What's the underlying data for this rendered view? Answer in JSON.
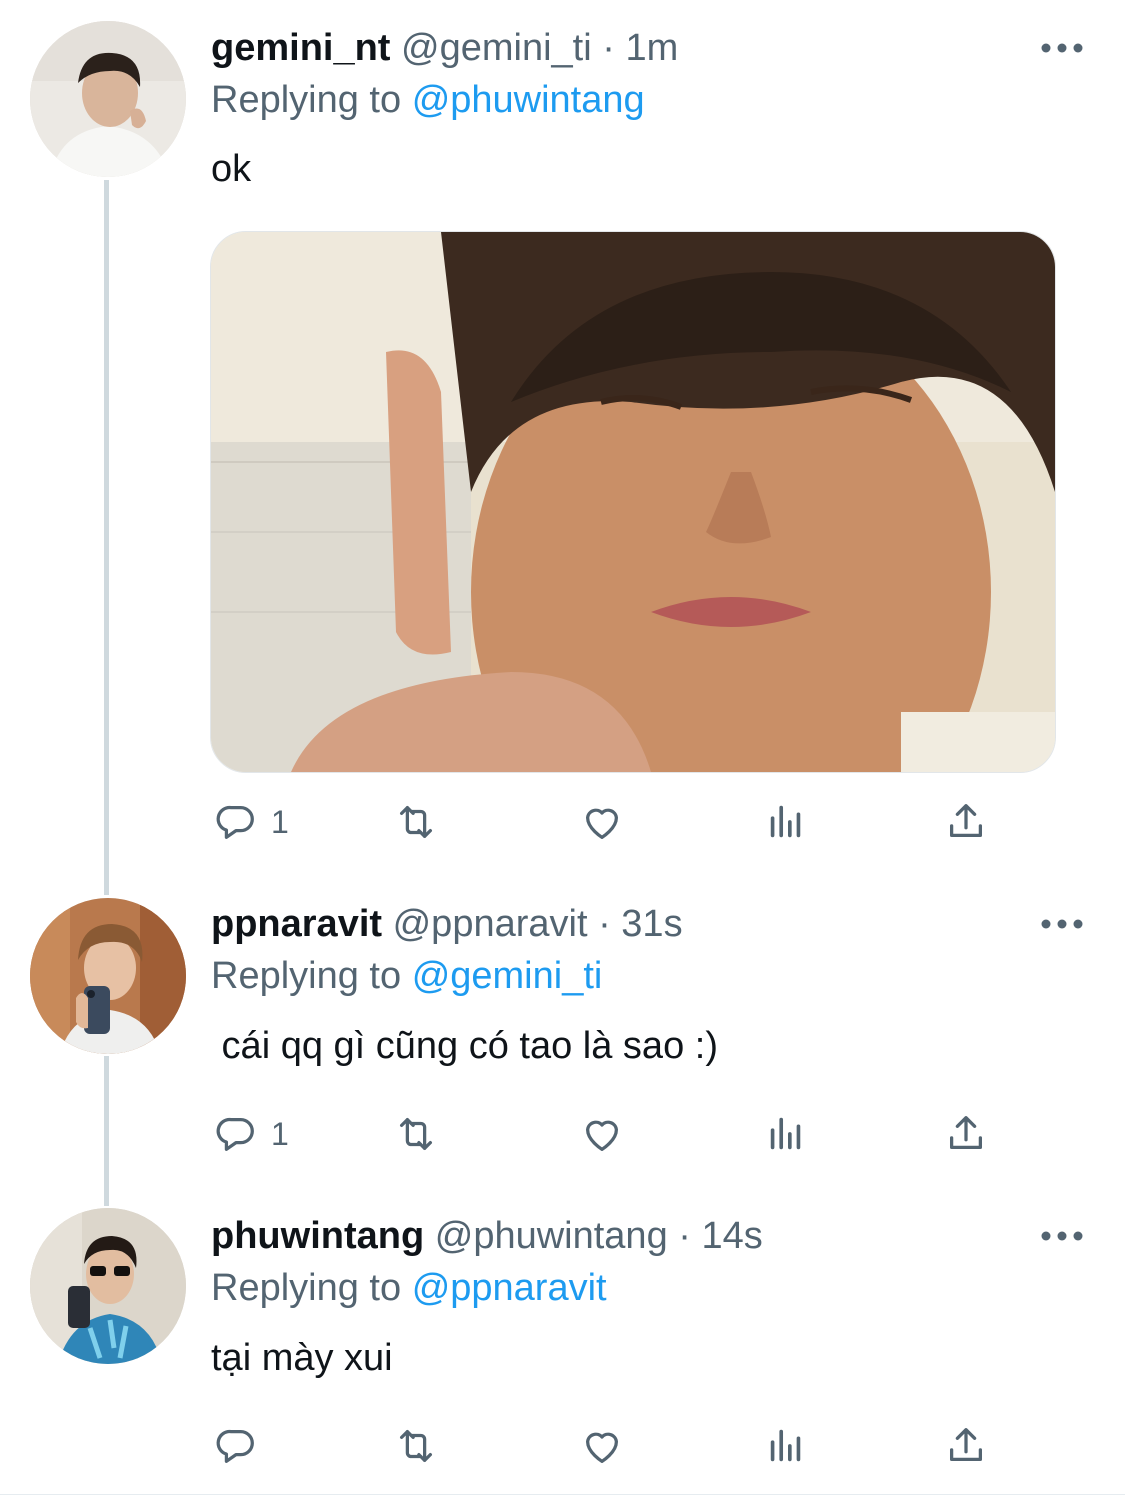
{
  "tweets": [
    {
      "name": "gemini_nt",
      "handle": "@gemini_ti",
      "time": "1m",
      "replying_prefix": "Replying to",
      "replying_to": "@phuwintang",
      "text": "ok",
      "has_media": true,
      "reply_count": "1"
    },
    {
      "name": "ppnaravit",
      "handle": "@ppnaravit",
      "time": "31s",
      "replying_prefix": "Replying to",
      "replying_to": "@gemini_ti",
      "text": " cái qq gì cũng có tao là sao :)",
      "has_media": false,
      "reply_count": "1"
    },
    {
      "name": "phuwintang",
      "handle": "@phuwintang",
      "time": "14s",
      "replying_prefix": "Replying to",
      "replying_to": "@ppnaravit",
      "text": "tại mày xui",
      "has_media": false,
      "reply_count": ""
    }
  ],
  "separator": "·",
  "icons": {
    "reply": "reply-icon",
    "retweet": "retweet-icon",
    "like": "like-icon",
    "views": "views-icon",
    "share": "share-icon",
    "more": "more-icon"
  },
  "colors": {
    "accent": "#1d9bf0",
    "secondary_text": "#536471",
    "primary_text": "#0f1419",
    "thread_line": "#cfd9de"
  }
}
